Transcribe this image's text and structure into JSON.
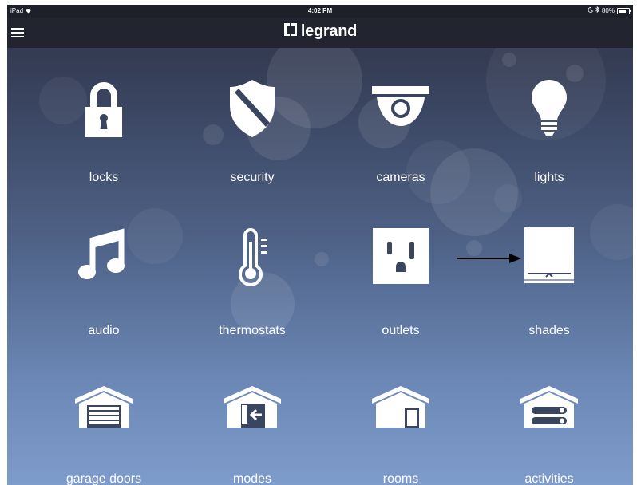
{
  "status_bar": {
    "device": "iPad",
    "time": "4:02 PM",
    "battery": "80%",
    "battery_level": 0.8
  },
  "header": {
    "brand": "legrand",
    "menu_icon": "hamburger-menu-icon",
    "logo_icon": "legrand-logo-icon"
  },
  "tiles": [
    {
      "label": "locks",
      "icon": "lock-icon"
    },
    {
      "label": "security",
      "icon": "shield-icon"
    },
    {
      "label": "cameras",
      "icon": "security-camera-icon"
    },
    {
      "label": "lights",
      "icon": "light-bulb-icon"
    },
    {
      "label": "audio",
      "icon": "music-note-icon"
    },
    {
      "label": "thermostats",
      "icon": "thermometer-icon"
    },
    {
      "label": "outlets",
      "icon": "power-outlet-icon"
    },
    {
      "label": "shades",
      "icon": "window-shade-icon"
    },
    {
      "label": "garage doors",
      "icon": "garage-door-icon"
    },
    {
      "label": "modes",
      "icon": "house-enter-icon"
    },
    {
      "label": "rooms",
      "icon": "house-icon"
    },
    {
      "label": "activities",
      "icon": "house-toggles-icon"
    }
  ],
  "annotation": {
    "icon": "arrow-right-icon",
    "target": "shades"
  },
  "colors": {
    "navbar": "#22252f",
    "status_bar": "#1e2029",
    "background_top": "#2e3346",
    "background_bottom": "#7e9ccb",
    "foreground": "#ffffff"
  }
}
